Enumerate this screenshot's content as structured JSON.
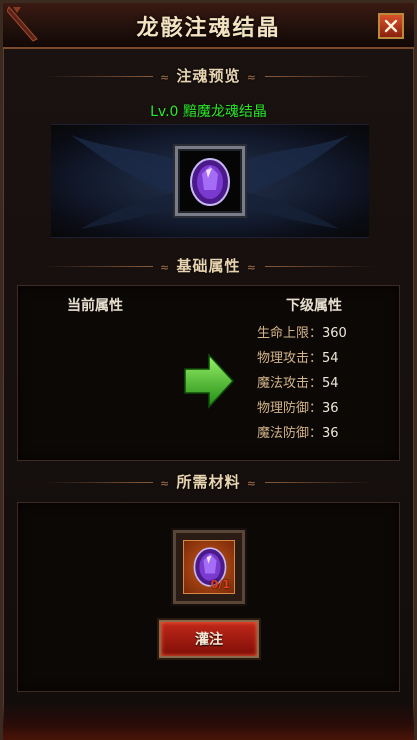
{
  "window": {
    "title": "龙骸注魂结晶",
    "close_icon": "close-icon"
  },
  "preview": {
    "header": "注魂预览",
    "item_name": "Lv.0 黯魔龙魂结晶",
    "item_icon": "purple-gem-icon"
  },
  "attributes": {
    "header": "基础属性",
    "current_label": "当前属性",
    "next_label": "下级属性",
    "next_stats": [
      {
        "name": "生命上限：",
        "value": "360"
      },
      {
        "name": "物理攻击：",
        "value": "54"
      },
      {
        "name": "魔法攻击：",
        "value": "54"
      },
      {
        "name": "物理防御：",
        "value": "36"
      },
      {
        "name": "魔法防御：",
        "value": "36"
      }
    ],
    "arrow_icon": "green-arrow-right-icon"
  },
  "materials": {
    "header": "所需材料",
    "item_icon": "purple-gem-icon",
    "count_text": "0/1",
    "button_label": "灌注"
  },
  "colors": {
    "item_name_green": "#2ce82c",
    "stat_label_tan": "#d2b48a",
    "button_red": "#c2281a"
  }
}
